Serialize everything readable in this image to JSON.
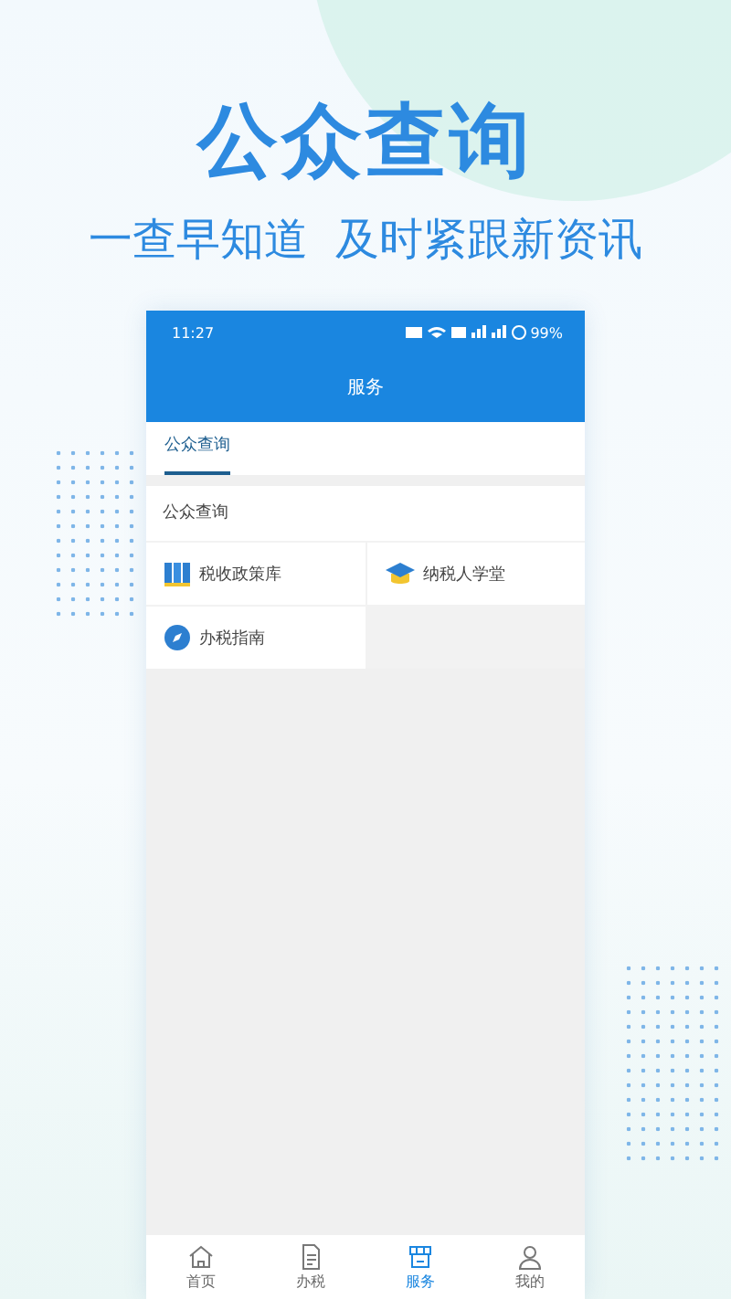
{
  "headline": "公众查询",
  "tagline": "一查早知道  及时紧跟新资讯",
  "phone": {
    "status_bar": {
      "time": "11:27",
      "battery": "99%"
    },
    "title": "服务",
    "tabs": [
      {
        "label": "公众查询",
        "selected": true
      }
    ],
    "section": {
      "title": "公众查询",
      "items": [
        {
          "label": "税收政策库",
          "kind": "books"
        },
        {
          "label": "纳税人学堂",
          "kind": "cap"
        },
        {
          "label": "办税指南",
          "kind": "compass"
        }
      ]
    },
    "bottom_nav": [
      {
        "label": "首页",
        "kind": "home",
        "selected": false
      },
      {
        "label": "办税",
        "kind": "doc",
        "selected": false
      },
      {
        "label": "服务",
        "kind": "shop",
        "selected": true
      },
      {
        "label": "我的",
        "kind": "user",
        "selected": false
      }
    ]
  }
}
